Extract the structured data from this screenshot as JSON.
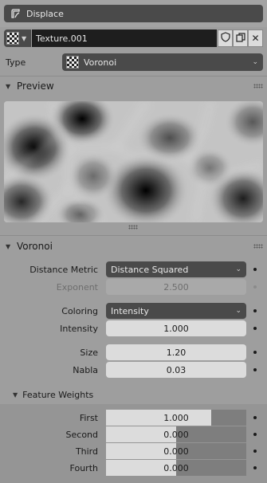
{
  "modifier": {
    "name": "Displace",
    "icon": "displace-modifier-icon"
  },
  "texture": {
    "name": "Texture.001",
    "fake_user_icon": "shield-icon",
    "duplicate_icon": "duplicate-icon",
    "unlink_icon": "close-icon"
  },
  "type": {
    "label": "Type",
    "value": "Voronoi",
    "icon": "checker-texture-icon"
  },
  "preview_panel": {
    "title": "Preview"
  },
  "voronoi_panel": {
    "title": "Voronoi",
    "distance_metric": {
      "label": "Distance Metric",
      "value": "Distance Squared"
    },
    "exponent": {
      "label": "Exponent",
      "value": "2.500"
    },
    "coloring": {
      "label": "Coloring",
      "value": "Intensity"
    },
    "intensity": {
      "label": "Intensity",
      "value": "1.000"
    },
    "size": {
      "label": "Size",
      "value": "1.20"
    },
    "nabla": {
      "label": "Nabla",
      "value": "0.03"
    }
  },
  "feature_weights": {
    "title": "Feature Weights",
    "weights": [
      {
        "label": "First",
        "value": "1.000",
        "fraction": 0.75
      },
      {
        "label": "Second",
        "value": "0.000",
        "fraction": 0.5
      },
      {
        "label": "Third",
        "value": "0.000",
        "fraction": 0.5
      },
      {
        "label": "Fourth",
        "value": "0.000",
        "fraction": 0.5
      }
    ]
  },
  "colors": {
    "accent_dark": "#4a4a4a",
    "field_light": "#dcdcdc",
    "panel_bg": "#9e9e9e"
  }
}
